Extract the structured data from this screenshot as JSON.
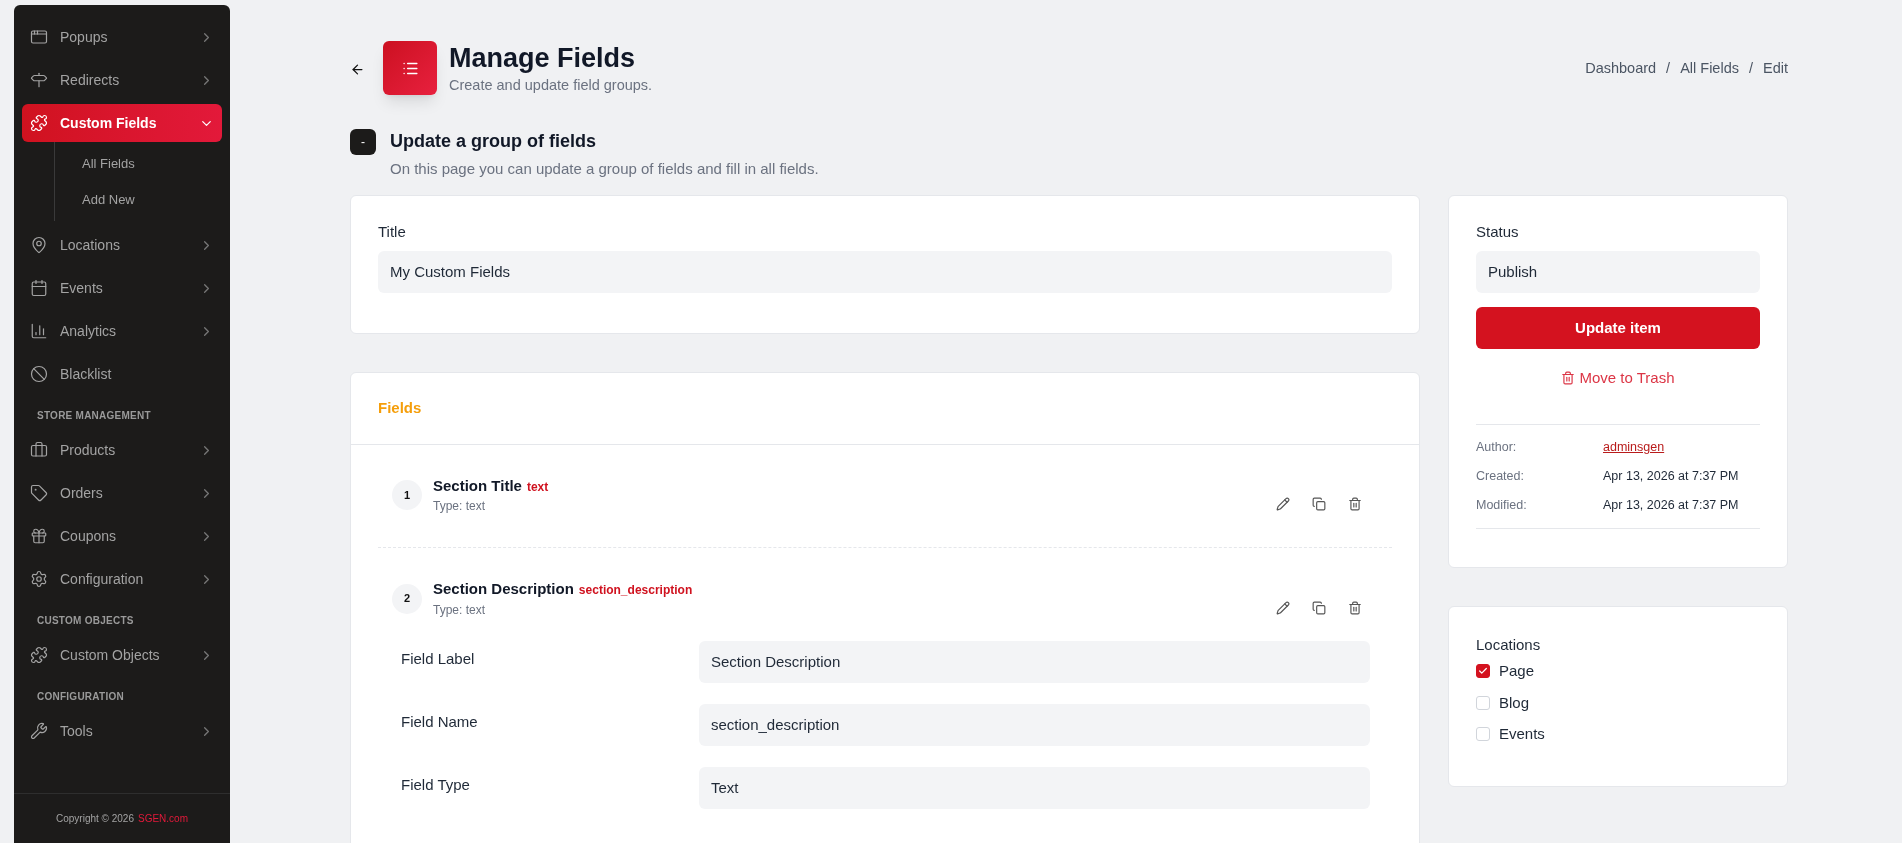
{
  "sidebar": {
    "groups": [
      {
        "items": [
          {
            "label": "Popups",
            "expanded": false,
            "selected": false
          },
          {
            "label": "Redirects",
            "expanded": false,
            "selected": false
          },
          {
            "label": "Custom Fields",
            "expanded": true,
            "selected": true,
            "children": [
              {
                "label": "All Fields"
              },
              {
                "label": "Add New"
              }
            ]
          },
          {
            "label": "Locations",
            "expanded": false,
            "selected": false
          },
          {
            "label": "Events",
            "expanded": false,
            "selected": false
          },
          {
            "label": "Analytics",
            "expanded": false,
            "selected": false
          },
          {
            "label": "Blacklist",
            "selected": false
          }
        ]
      },
      {
        "heading": "STORE MANAGEMENT",
        "items": [
          {
            "label": "Products",
            "expanded": false,
            "selected": false
          },
          {
            "label": "Orders",
            "expanded": false,
            "selected": false
          },
          {
            "label": "Coupons",
            "expanded": false,
            "selected": false
          },
          {
            "label": "Configuration",
            "expanded": false,
            "selected": false
          }
        ]
      },
      {
        "heading": "CUSTOM OBJECTS",
        "items": [
          {
            "label": "Custom Objects",
            "expanded": false,
            "selected": false
          }
        ]
      },
      {
        "heading": "CONFIGURATION",
        "items": [
          {
            "label": "Tools",
            "expanded": false,
            "selected": false
          }
        ]
      }
    ],
    "footer": {
      "text": "Copyright © 2026",
      "link": "SGEN.com"
    }
  },
  "header": {
    "title": "Manage Fields",
    "subtitle": "Create and update field groups.",
    "breadcrumbs": [
      {
        "kind": "link",
        "text": "Dashboard"
      },
      {
        "kind": "separator",
        "text": "/"
      },
      {
        "kind": "link",
        "text": "All Fields"
      },
      {
        "kind": "separator",
        "text": "/"
      },
      {
        "kind": "link",
        "text": "Edit"
      }
    ]
  },
  "section": {
    "badge": "-",
    "title": "Update a group of fields",
    "description": "On this page you can update a group of fields and fill in all fields."
  },
  "title_card": {
    "label": "Title",
    "value": "My Custom Fields"
  },
  "fields_card": {
    "heading": "Fields",
    "fields": [
      {
        "number": "1",
        "name": "Section Title",
        "key": "text",
        "type": "Type: text"
      },
      {
        "number": "2",
        "name": "Section Description",
        "key": "section_description",
        "type": "Type: text",
        "settings": [
          {
            "label": "Field Label",
            "value": "Section Description"
          },
          {
            "label": "Field Name",
            "value": "section_description"
          },
          {
            "label": "Field Type",
            "value": "Text"
          }
        ]
      }
    ]
  },
  "status_card": {
    "label": "Status",
    "value": "Publish",
    "primary_button": "Update item",
    "trash_link": "Move to Trash",
    "meta": [
      {
        "label": "Author:",
        "value": "adminsgen",
        "kind": "link"
      },
      {
        "label": "Created:",
        "value": "Apr 13, 2026 at 7:37 PM",
        "kind": "text"
      },
      {
        "label": "Modified:",
        "value": "Apr 13, 2026 at 7:37 PM",
        "kind": "text"
      }
    ]
  },
  "locations_card": {
    "label": "Locations",
    "options": [
      {
        "label": "Page",
        "checked": true
      },
      {
        "label": "Blog",
        "checked": false
      },
      {
        "label": "Events",
        "checked": false
      }
    ]
  }
}
